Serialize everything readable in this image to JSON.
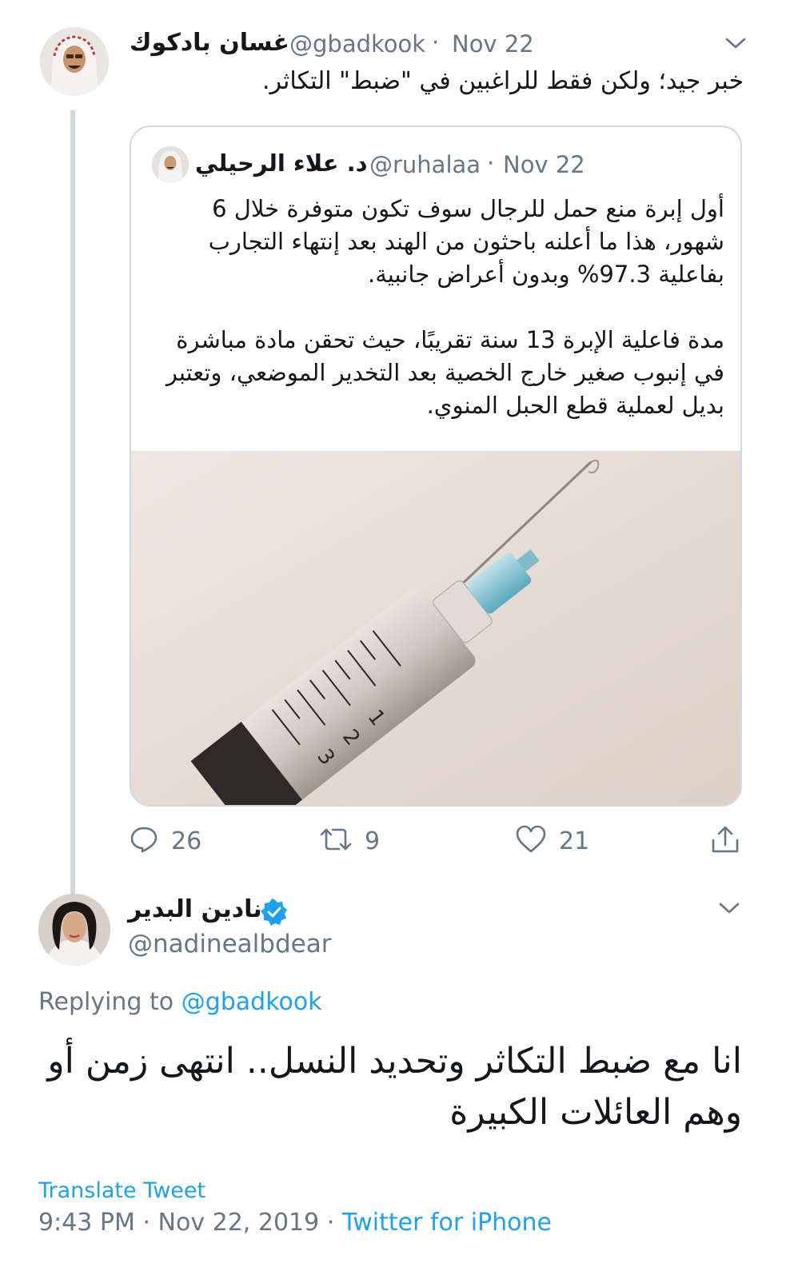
{
  "colors": {
    "accent": "#1da1f2",
    "secondary_text": "#657786",
    "primary_text": "#14171a",
    "border": "#cfd9de"
  },
  "quoted_thread": {
    "author_name": "غسان بادكوك",
    "handle": "@gbadkook",
    "separator": "·",
    "date": "Nov 22",
    "text": "خبر جيد؛ ولكن فقط للراغبين في \"ضبط\" التكاثر.",
    "menu_icon": "chevron-down-icon",
    "quote": {
      "author_name": "د. علاء الرحيلي",
      "handle": "@ruhalaa",
      "separator": "·",
      "date": "Nov 22",
      "paragraph1": "أول إبرة منع حمل للرجال سوف تكون متوفرة خلال 6 شهور، هذا ما أعلنه باحثون من الهند بعد إنتهاء التجارب بفاعلية 97.3% وبدون أعراض جانبية.",
      "paragraph2": "مدة فاعلية الإبرة 13 سنة تقريبًا، حيث تحقن مادة مباشرة في إنبوب صغير خارج الخصية بعد التخدير الموضعي، وتعتبر بديل لعملية قطع الحبل المنوي.",
      "image_markings": [
        "1",
        "2",
        "3"
      ]
    },
    "actions": {
      "reply_count": "26",
      "retweet_count": "9",
      "like_count": "21",
      "icons": [
        "reply-icon",
        "retweet-icon",
        "like-icon",
        "share-icon"
      ]
    }
  },
  "main_tweet": {
    "author_name": "نادين البدير",
    "verified_icon": "verified-badge-icon",
    "handle": "@nadinealbdear",
    "replying_prefix": "Replying to",
    "replying_to": "@gbadkook",
    "text": "انا مع ضبط التكاثر وتحديد النسل.. انتهى زمن أو وهم العائلات الكبيرة",
    "translate_label": "Translate Tweet",
    "time": "9:43 PM",
    "separator": "·",
    "date": "Nov 22, 2019",
    "source": "Twitter for iPhone"
  }
}
